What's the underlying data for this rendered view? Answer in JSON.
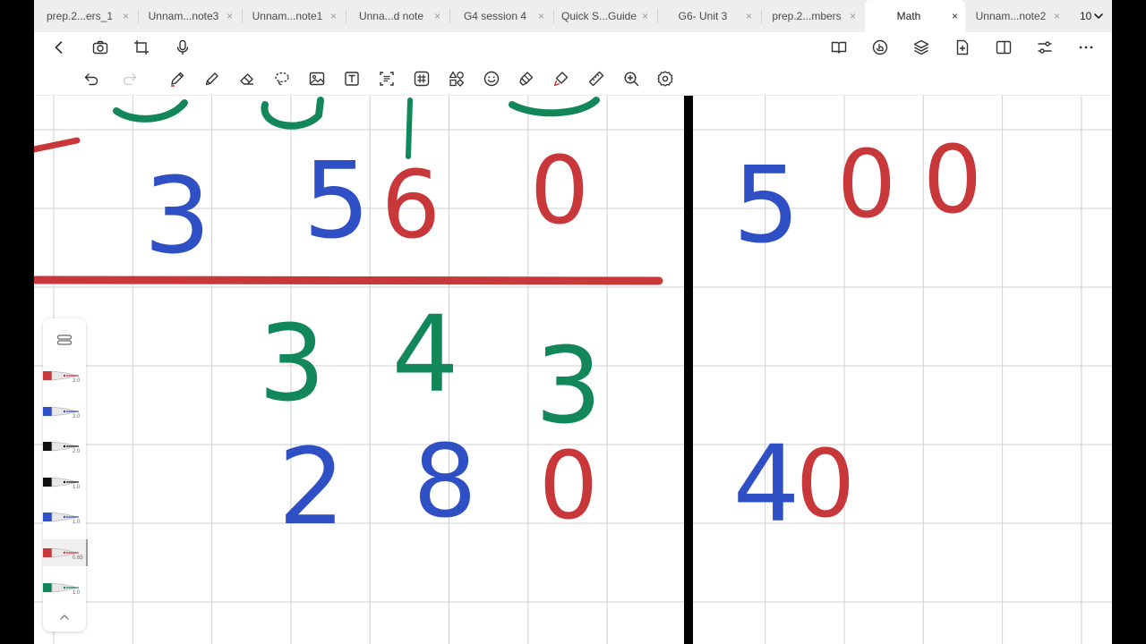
{
  "tabs": [
    {
      "label": "prep.2...ers_1",
      "active": false
    },
    {
      "label": "Unnam...note3",
      "active": false
    },
    {
      "label": "Unnam...note1",
      "active": false
    },
    {
      "label": "Unna...d note",
      "active": false
    },
    {
      "label": "G4 session 4",
      "active": false
    },
    {
      "label": "Quick S...Guide",
      "active": false
    },
    {
      "label": "G6- Unit 3",
      "active": false
    },
    {
      "label": "prep.2...mbers",
      "active": false
    },
    {
      "label": "Math",
      "active": true
    },
    {
      "label": "Unnam...note2",
      "active": false
    }
  ],
  "tab_count": "10",
  "tab_close_glyph": "×",
  "nav_toolbar": {
    "left": [
      "back-icon",
      "camera-icon",
      "crop-icon",
      "microphone-icon"
    ],
    "right": [
      "book-icon",
      "touch-icon",
      "layers-icon",
      "add-page-icon",
      "split-view-icon",
      "settings-sliders-icon",
      "more-icon"
    ]
  },
  "tool_toolbar": [
    "undo-icon",
    "redo-icon",
    "pen-icon",
    "pencil-icon",
    "eraser-icon",
    "lasso-icon",
    "image-icon",
    "text-box-icon",
    "ocr-icon",
    "table-icon",
    "shapes-icon",
    "sticker-icon",
    "highlighter-icon",
    "laser-pointer-icon",
    "ruler-icon",
    "zoom-icon",
    "gear-icon"
  ],
  "handwriting": {
    "left": {
      "row1": [
        "3",
        "5",
        "6",
        "0"
      ],
      "row2": [
        "3",
        "4",
        "3"
      ],
      "row3": [
        "2",
        "8",
        "0"
      ]
    },
    "right": {
      "row1": [
        "5",
        "0",
        "0"
      ],
      "row2": [
        "4",
        "0"
      ]
    }
  },
  "ink_colors": {
    "blue": "#2f50c4",
    "red": "#c8383b",
    "green": "#12875a",
    "black": "#111111"
  },
  "pens": [
    {
      "color": "#c8383b",
      "width": "2.0",
      "selected": false
    },
    {
      "color": "#2f50c4",
      "width": "2.0",
      "selected": false
    },
    {
      "color": "#111111",
      "width": "2.0",
      "selected": false
    },
    {
      "color": "#111111",
      "width": "1.0",
      "selected": false
    },
    {
      "color": "#2f50c4",
      "width": "1.0",
      "selected": false
    },
    {
      "color": "#c8383b",
      "width": "0.65",
      "selected": true
    },
    {
      "color": "#12875a",
      "width": "1.0",
      "selected": false
    }
  ]
}
